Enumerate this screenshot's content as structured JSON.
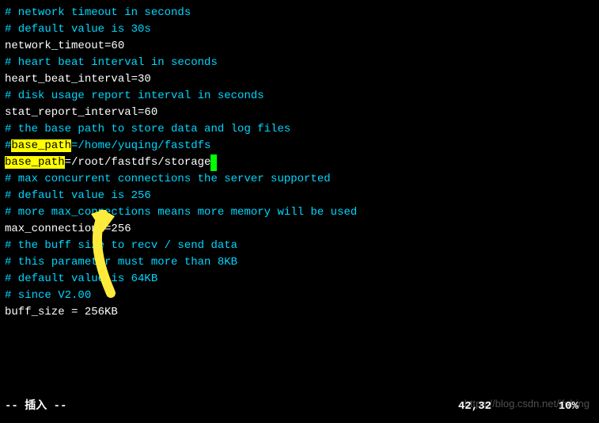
{
  "lines": {
    "l1": "# network timeout in seconds",
    "l2": "# default value is 30s",
    "l3": "network_timeout=60",
    "l4": "",
    "l5": "# heart beat interval in seconds",
    "l6": "heart_beat_interval=30",
    "l7": "",
    "l8": "# disk usage report interval in seconds",
    "l9": "stat_report_interval=60",
    "l10": "",
    "l11": "# the base path to store data and log files",
    "l12_hash": "#",
    "l12_hl": "base_path",
    "l12_rest": "=/home/yuqing/fastdfs",
    "l13_hl": "base_path",
    "l13_rest": "=/root/fastdfs/storage",
    "l14": "",
    "l15": "# max concurrent connections the server supported",
    "l16": "# default value is 256",
    "l17": "# more max_connections means more memory will be used",
    "l18": "max_connections=256",
    "l19": "",
    "l20": "# the buff size to recv / send data",
    "l21": "# this parameter must more than 8KB",
    "l22": "# default value is 64KB",
    "l23": "# since V2.00",
    "l24": "buff_size = 256KB",
    "l25": ""
  },
  "status": {
    "mode": "-- 插入 --",
    "position": "42,32",
    "percent": "10%"
  },
  "watermark": "https://blog.csdn.net/ifubing"
}
